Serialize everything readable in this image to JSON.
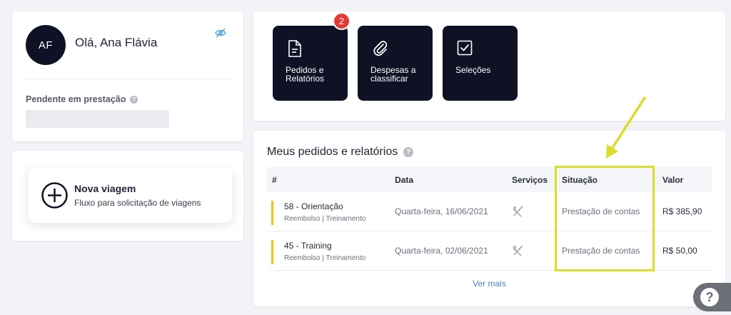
{
  "profile": {
    "initials": "AF",
    "greeting": "Olá, Ana Flávia",
    "pending_label": "Pendente em prestação",
    "help": "?"
  },
  "new_trip": {
    "title": "Nova viagem",
    "subtitle": "Fluxo para solicitação de viagens"
  },
  "shortcuts": [
    {
      "label": "Pedidos e Relatórios",
      "icon": "document-icon",
      "badge": "2"
    },
    {
      "label": "Despesas a classificar",
      "icon": "paperclip-icon"
    },
    {
      "label": "Seleções",
      "icon": "checkbox-icon"
    }
  ],
  "orders": {
    "title": "Meus pedidos e relatórios",
    "help": "?",
    "columns": [
      "#",
      "Data",
      "Serviços",
      "Situação",
      "Valor"
    ],
    "rows": [
      {
        "title": "58 - Orientação",
        "sub": "Reembolso | Treinamento",
        "date": "Quarta-feira, 16/06/2021",
        "service_icon": "fork-knife-icon",
        "status": "Prestação de contas",
        "value": "R$ 385,90"
      },
      {
        "title": "45 - Training",
        "sub": "Reembolso | Treinamento",
        "date": "Quarta-feira, 02/06/2021",
        "service_icon": "fork-knife-icon",
        "status": "Prestação de contas",
        "value": "R$ 50,00"
      }
    ],
    "see_more": "Ver mais"
  },
  "help_fab": "?",
  "colors": {
    "dark": "#0f1224",
    "badge": "#e53935",
    "accent_bar": "#f2c200",
    "annotation": "#dcdc2c",
    "link": "#4a7fc1"
  }
}
